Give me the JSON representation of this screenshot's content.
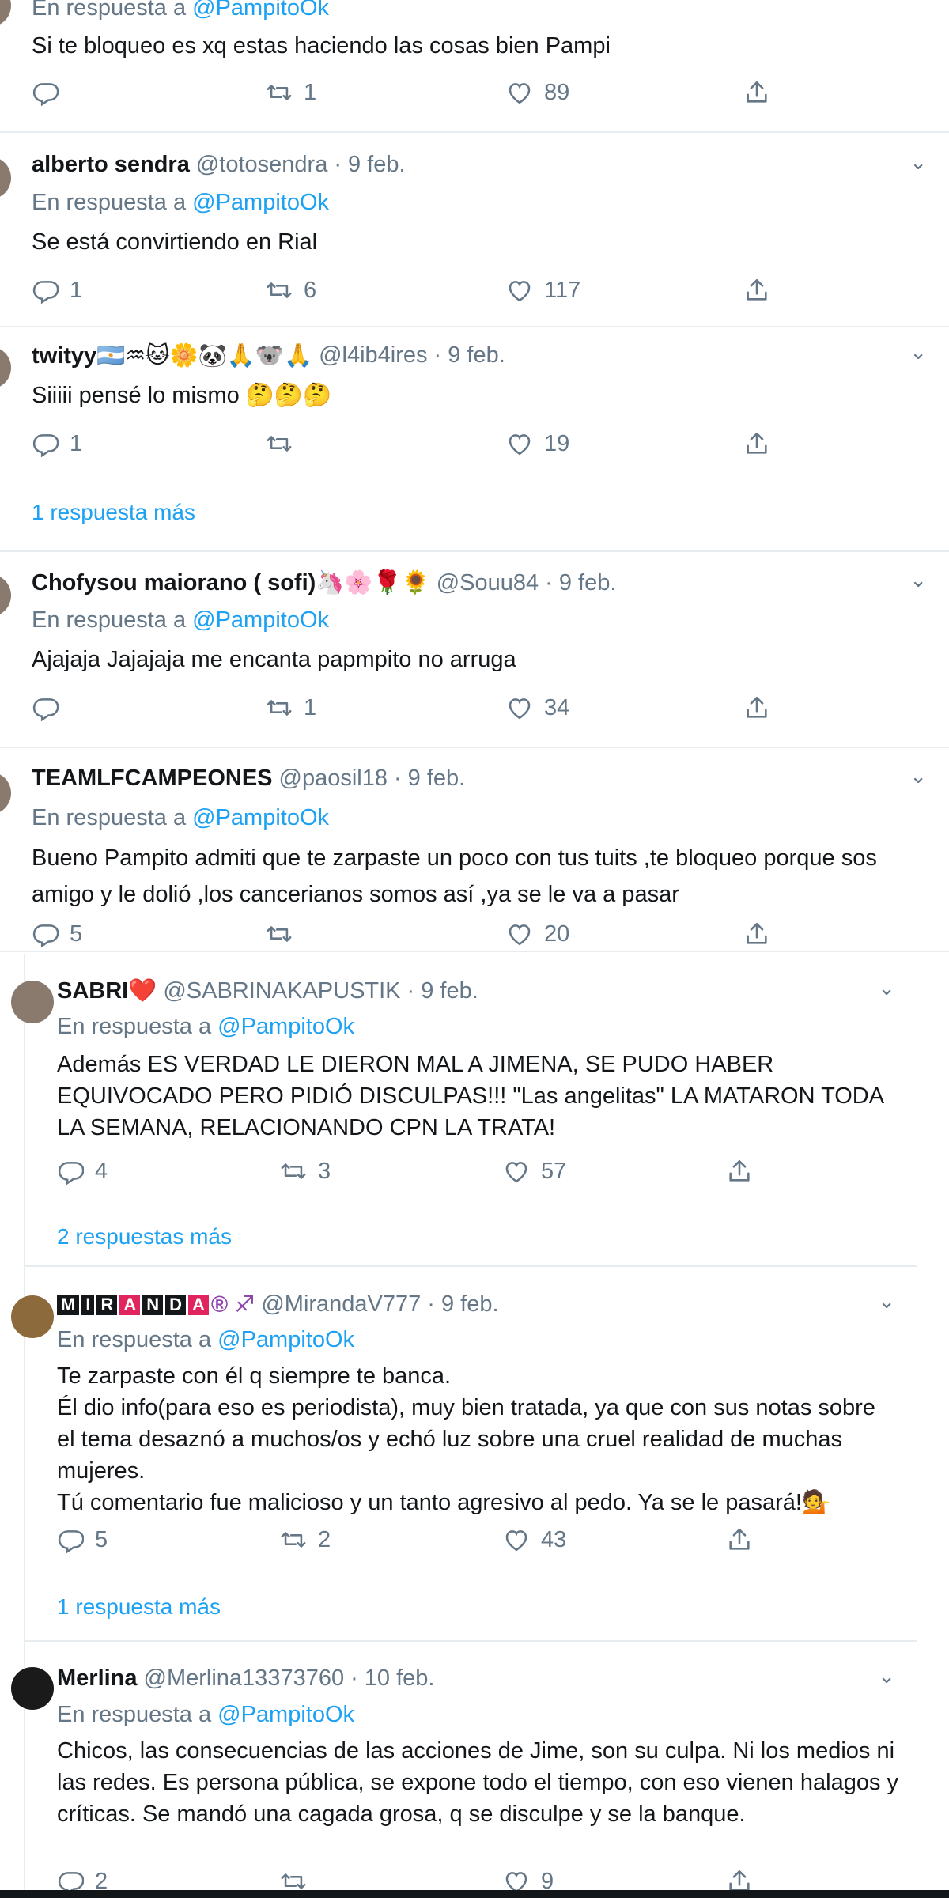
{
  "tweets": [
    {
      "reply_label": "En respuesta a",
      "reply_target": "@PampitoOk",
      "text": "Si te bloqueo es xq estas  haciendo las cosas bien Pampi",
      "replies": "",
      "retweets": "1",
      "likes": "89"
    },
    {
      "name": "alberto sendra",
      "handle": "@totosendra",
      "date": "9 feb.",
      "reply_label": "En respuesta a",
      "reply_target": "@PampitoOk",
      "text": "Se está convirtiendo en Rial",
      "replies": "1",
      "retweets": "6",
      "likes": "117"
    },
    {
      "name": "twityy🇦🇷♒🐱🌼🐼🙏🐨🙏",
      "handle": "@l4ib4ires",
      "date": "9 feb.",
      "text": "Siiiii pensé lo mismo 🤔🤔🤔",
      "replies": "1",
      "retweets": "",
      "likes": "19",
      "more": "1 respuesta más"
    },
    {
      "name": "Chofysou maiorano ( sofi)🦄🌸🌹🌻",
      "handle": "@Souu84",
      "date": "9 feb.",
      "reply_label": "En respuesta a",
      "reply_target": "@PampitoOk",
      "text": "Ajajaja Jajajaja me encanta  papmpito no arruga",
      "replies": "",
      "retweets": "1",
      "likes": "34"
    },
    {
      "name": "TEAMLFCAMPEONES",
      "handle": "@paosil18",
      "date": "9 feb.",
      "reply_label": "En respuesta a",
      "reply_target": "@PampitoOk",
      "text": "Bueno Pampito admiti que te zarpaste un poco con tus tuits ,te bloqueo porque sos amigo y le dolió ,los cancerianos somos así ,ya se le va a pasar",
      "replies": "5",
      "retweets": "",
      "likes": "20"
    },
    {
      "name": "SABRI❤️",
      "handle": "@SABRINAKAPUSTIK",
      "date": "9 feb.",
      "reply_label": "En respuesta a",
      "reply_target": "@PampitoOk",
      "text": "Además ES VERDAD LE DIERON MAL A JIMENA, SE PUDO HABER EQUIVOCADO PERO PIDIÓ DISCULPAS!!! \"Las angelitas\" LA MATARON TODA LA SEMANA, RELACIONANDO CPN LA TRATA!",
      "replies": "4",
      "retweets": "3",
      "likes": "57",
      "more": "2 respuestas más"
    },
    {
      "name": "MIRANDA®",
      "name_letters": [
        "M",
        "I",
        "R",
        "A",
        "N",
        "D",
        "A"
      ],
      "name_suffix": "® ♐",
      "handle": "@MirandaV777",
      "date": "9 feb.",
      "reply_label": "En respuesta a",
      "reply_target": "@PampitoOk",
      "text": "Te zarpaste con él q siempre te banca.\nÉl dio info(para eso es periodista), muy bien tratada, ya que con sus notas sobre el tema desaznó a muchos/os y echó luz sobre una cruel realidad de muchas mujeres.\nTú comentario fue malicioso y un tanto agresivo al pedo. Ya se le pasará!💁",
      "replies": "5",
      "retweets": "2",
      "likes": "43",
      "more": "1 respuesta más"
    },
    {
      "name": "Merlina",
      "handle": "@Merlina13373760",
      "date": "10 feb.",
      "reply_label": "En respuesta a",
      "reply_target": "@PampitoOk",
      "text": "Chicos, las consecuencias de las acciones de Jime, son su culpa. Ni los medios ni las redes. Es persona pública, se expone todo el tiempo, con eso vienen halagos y críticas. Se mandó una cagada grosa, q se disculpe y se la banque.",
      "replies": "2",
      "retweets": "",
      "likes": "9"
    }
  ],
  "separator": "·",
  "icons": {
    "reply": "reply-icon",
    "retweet": "retweet-icon",
    "like": "heart-icon",
    "share": "share-icon",
    "menu": "chevron-down-icon"
  },
  "colors": {
    "link": "#1da1f2",
    "muted": "#657786",
    "text": "#14171a",
    "divider": "#e6ecf0"
  }
}
